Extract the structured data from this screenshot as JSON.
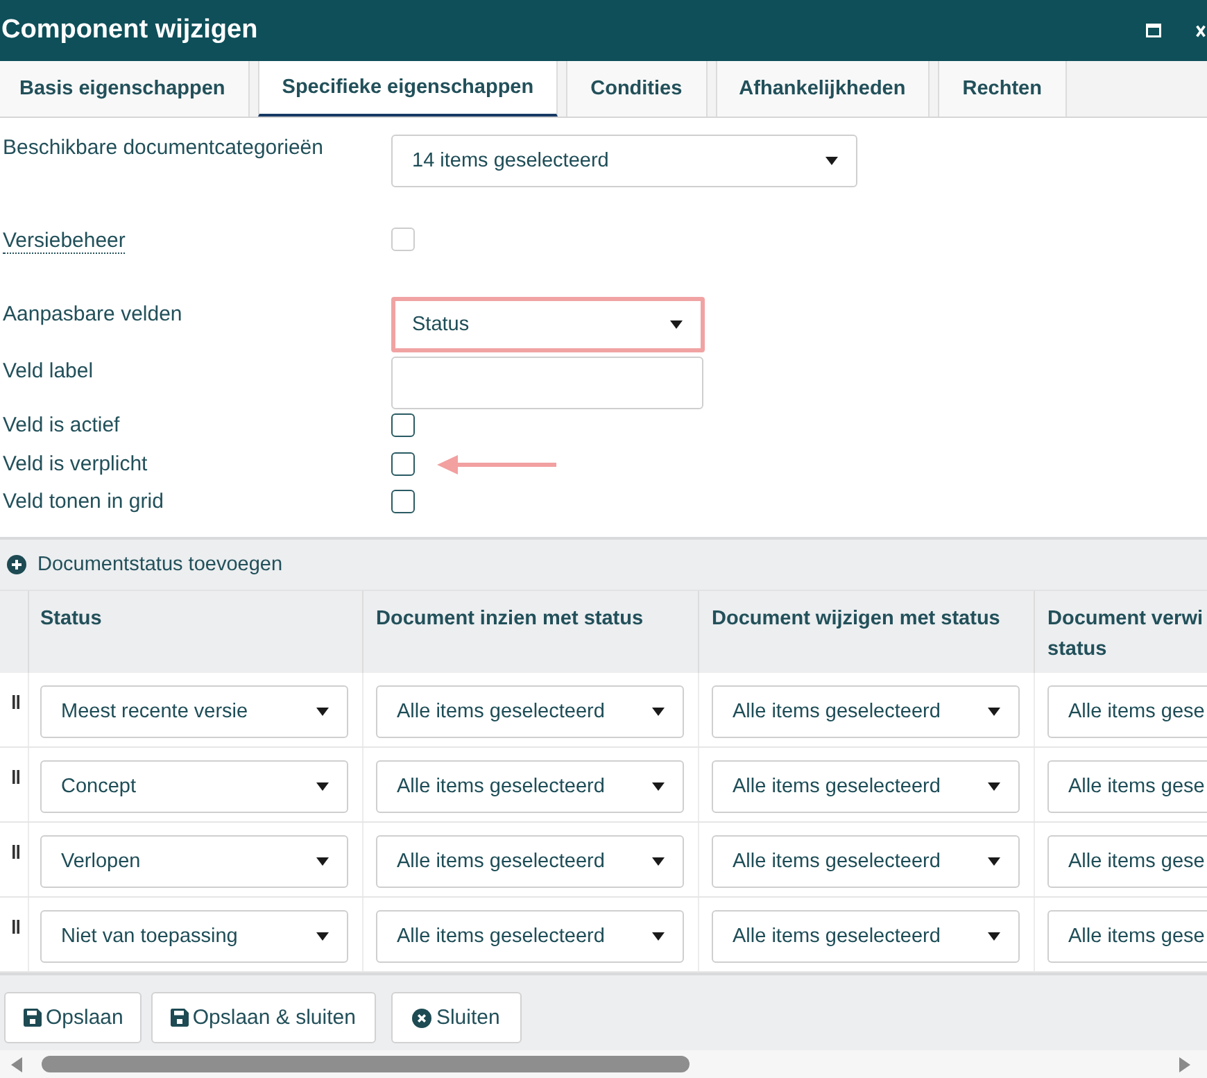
{
  "window": {
    "title": "Component wijzigen"
  },
  "tabs": [
    {
      "label": "Basis eigenschappen",
      "selected": false
    },
    {
      "label": "Specifieke eigenschappen",
      "selected": true
    },
    {
      "label": "Condities",
      "selected": false
    },
    {
      "label": "Afhankelijkheden",
      "selected": false
    },
    {
      "label": "Rechten",
      "selected": false
    }
  ],
  "form": {
    "fields": [
      {
        "kind": "select",
        "label": "Beschikbare documentcategorieën",
        "has_tooltip": false,
        "value": "14 items geselecteerd",
        "highlighted": false
      },
      {
        "kind": "checkbox",
        "label": "Versiebeheer",
        "has_tooltip": true,
        "checked": false,
        "disabled": true,
        "annotation_arrow": false
      },
      {
        "kind": "select",
        "label": "Aanpasbare velden",
        "has_tooltip": false,
        "value": "Status",
        "highlighted": true
      },
      {
        "kind": "text",
        "label": "Veld label",
        "has_tooltip": false,
        "highlighted": false
      },
      {
        "kind": "checkbox",
        "label": "Veld is actief",
        "has_tooltip": false,
        "checked": false,
        "disabled": false,
        "annotation_arrow": false
      },
      {
        "kind": "checkbox",
        "label": "Veld is verplicht",
        "has_tooltip": false,
        "checked": false,
        "disabled": false,
        "annotation_arrow": true
      },
      {
        "kind": "checkbox",
        "label": "Veld tonen in grid",
        "has_tooltip": false,
        "checked": false,
        "disabled": false,
        "annotation_arrow": false
      }
    ]
  },
  "table": {
    "add_button": {
      "label": "Documentstatus toevoegen"
    },
    "columns": [
      {
        "label": "Status"
      },
      {
        "label": "Document inzien met status"
      },
      {
        "label": "Document wijzigen met status"
      },
      {
        "label": "Document verwi status"
      }
    ],
    "rows": [
      {
        "cells": [
          "Meest recente versie",
          "Alle items geselecteerd",
          "Alle items geselecteerd",
          "Alle items gese"
        ]
      },
      {
        "cells": [
          "Concept",
          "Alle items geselecteerd",
          "Alle items geselecteerd",
          "Alle items gese"
        ]
      },
      {
        "cells": [
          "Verlopen",
          "Alle items geselecteerd",
          "Alle items geselecteerd",
          "Alle items gese"
        ]
      },
      {
        "cells": [
          "Niet van toepassing",
          "Alle items geselecteerd",
          "Alle items geselecteerd",
          "Alle items gese"
        ]
      }
    ]
  },
  "footer": {
    "buttons": [
      {
        "label": "Opslaan",
        "kind": "save"
      },
      {
        "label": "Opslaan & sluiten",
        "kind": "save"
      },
      {
        "label": "Sluiten",
        "kind": "close"
      }
    ]
  }
}
